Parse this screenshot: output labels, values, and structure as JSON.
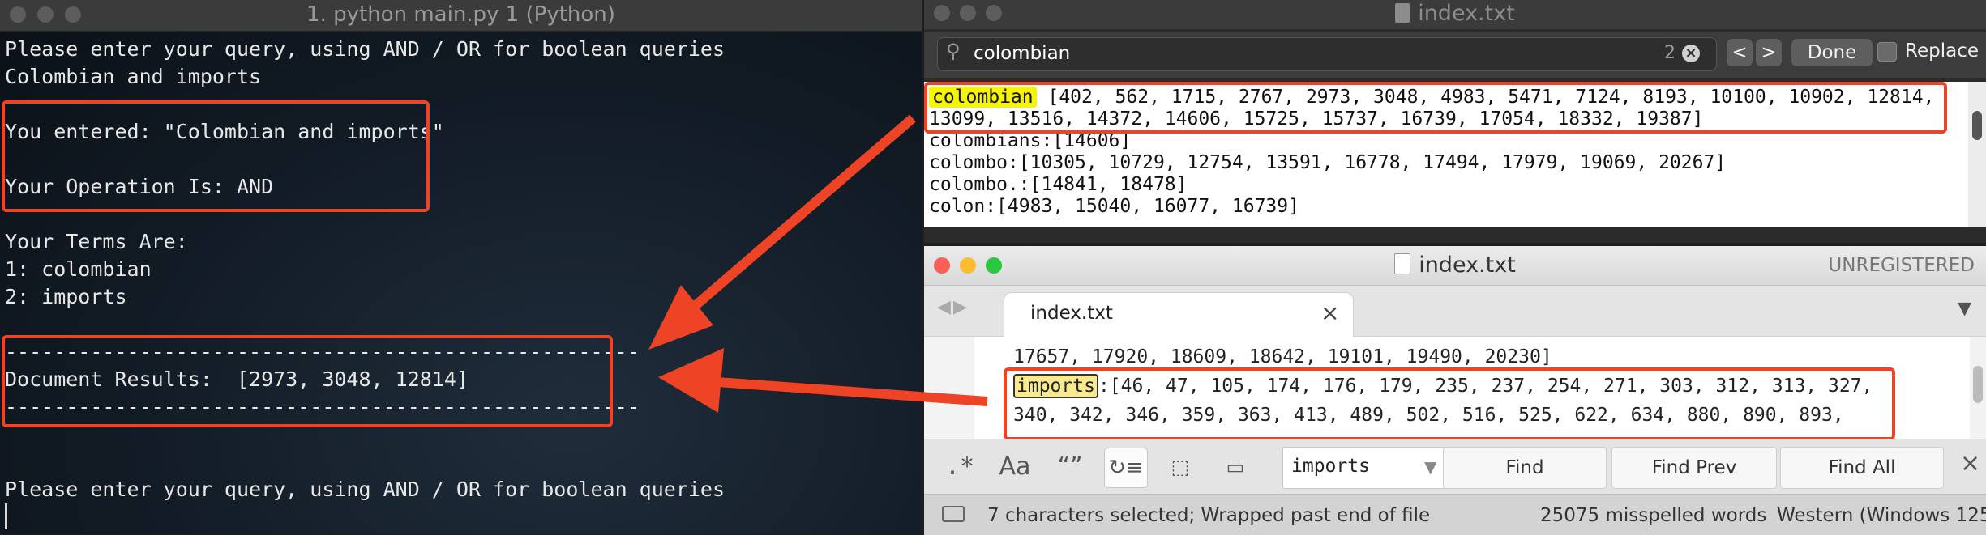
{
  "terminal": {
    "title": "1. python main.py 1 (Python)",
    "lines": [
      "Please enter your query, using AND / OR for boolean queries",
      "Colombian and imports",
      "You entered: \"Colombian and imports\"",
      "Your Operation Is: AND",
      "Your Terms Are:",
      "1: colombian",
      "2: imports",
      "----------------------------------------------------",
      "Document Results:  [2973, 3048, 12814]",
      "----------------------------------------------------",
      "Please enter your query, using AND / OR for boolean queries"
    ]
  },
  "find_window": {
    "title": "index.txt",
    "search_value": "colombian",
    "match_count": "2",
    "prev_label": "<",
    "next_label": ">",
    "done_label": "Done",
    "replace_label": "Replace",
    "highlight_term": "colombian",
    "lines": [
      " [402, 562, 1715, 2767, 2973, 3048, 4983, 5471, 7124, 8193, 10100, 10902, 12814,",
      "13099, 13516, 14372, 14606, 15725, 15737, 16739, 17054, 18332, 19387]",
      "colombians:[14606]",
      "colombo:[10305, 10729, 12754, 13591, 16778, 17494, 17979, 19069, 20267]",
      "colombo.:[14841, 18478]",
      "colon:[4983, 15040, 16077, 16739]"
    ]
  },
  "sublime": {
    "title": "index.txt",
    "unregistered": "UNREGISTERED",
    "tab_label": "index.txt",
    "tab_close": "×",
    "line_above": "17657, 17920, 18609, 18642, 19101, 19490, 20230]",
    "highlight_term": "imports",
    "line1_rest": ":[46, 47, 105, 174, 176, 179, 235, 237, 254, 271, 303, 312, 313, 327,",
    "line2": "340, 342, 346, 359, 363, 413, 489, 502, 516, 525, 622, 634, 880, 890, 893,",
    "find_panel": {
      "regex": ".*",
      "case": "Aa",
      "whole_word": "“”",
      "find_value": "imports",
      "find_label": "Find",
      "find_prev_label": "Find Prev",
      "find_all_label": "Find All",
      "close": "×"
    },
    "status": {
      "selection": "7 characters selected; Wrapped past end of file",
      "spelling": "25075 misspelled words",
      "encoding": "Western (Windows 125"
    }
  },
  "colors": {
    "annotation_red": "#ef4325",
    "highlight_yellow": "#f5f500",
    "sublime_highlight": "#f9e98f"
  }
}
